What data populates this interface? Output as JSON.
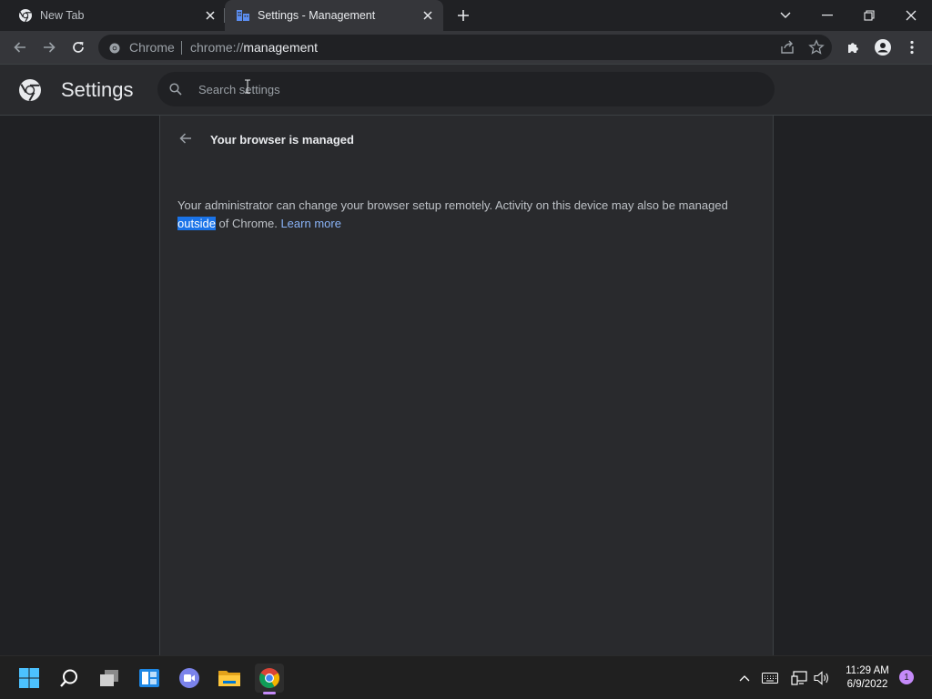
{
  "tabs": [
    {
      "title": "New Tab",
      "active": false
    },
    {
      "title": "Settings - Management",
      "active": true
    }
  ],
  "toolbar": {
    "site_chip": "Chrome",
    "url_scheme": "chrome://",
    "url_host": "management"
  },
  "settings": {
    "title": "Settings",
    "search_placeholder": "Search settings"
  },
  "page": {
    "heading": "Your browser is managed",
    "description_1": "Your administrator can change your browser setup remotely. Activity on this device may also be managed ",
    "description_selected": "outside",
    "description_2": " of Chrome. ",
    "learn_more": "Learn more"
  },
  "taskbar": {
    "apps": [
      "start-icon",
      "search-icon",
      "task-view-icon",
      "widgets-icon",
      "teams-chat-icon",
      "file-explorer-icon",
      "chrome-icon"
    ],
    "time": "11:29 AM",
    "date": "6/9/2022",
    "notification_count": "1"
  },
  "colors": {
    "accent": "#8ab4f8",
    "selection": "#1a73e8",
    "notification": "#c58af9"
  }
}
